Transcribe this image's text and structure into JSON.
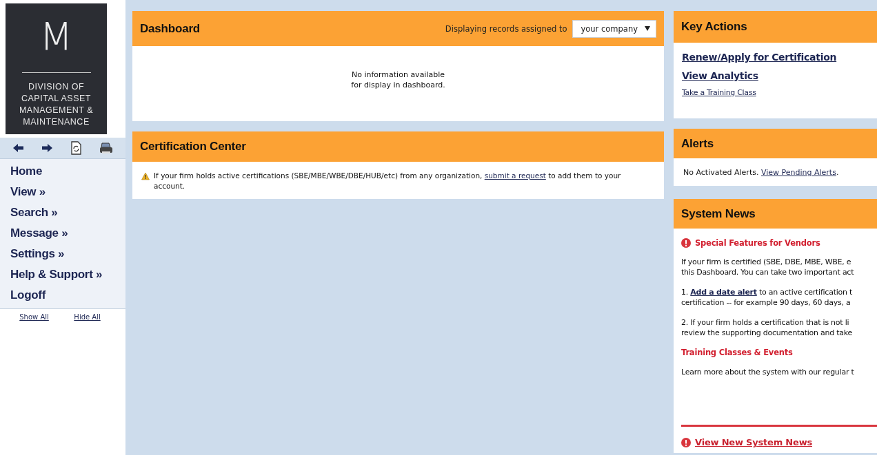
{
  "sidebar": {
    "logo": {
      "monogram": "M",
      "lines": [
        "DIVISION OF",
        "CAPITAL ASSET",
        "MANAGEMENT &",
        "MAINTENANCE"
      ]
    },
    "toolbar": [
      {
        "kind": "back"
      },
      {
        "kind": "forward"
      },
      {
        "kind": "refresh"
      },
      {
        "kind": "print"
      }
    ],
    "nav": [
      {
        "label": "Home"
      },
      {
        "label": "View »"
      },
      {
        "label": "Search »"
      },
      {
        "label": "Message »"
      },
      {
        "label": "Settings »"
      },
      {
        "label": "Help & Support »"
      },
      {
        "label": "Logoff"
      }
    ],
    "show_all": "Show All",
    "hide_all": "Hide All"
  },
  "dashboard": {
    "title": "Dashboard",
    "filter_label": "Displaying records assigned to",
    "filter_value": "your company",
    "message_lines": [
      "No information available",
      "for display in dashboard."
    ]
  },
  "certification_center": {
    "title": "Certification Center",
    "text_before": "If your firm holds active certifications (SBE/MBE/WBE/DBE/HUB/etc) from any organization, ",
    "link": "submit a request",
    "text_after": " to add them to your account."
  },
  "key_actions": {
    "title": "Key Actions",
    "links": [
      {
        "label": "Renew/Apply for Certification",
        "kind": "primary"
      },
      {
        "label": "View Analytics",
        "kind": "primary"
      },
      {
        "label": "Take a Training Class",
        "kind": "secondary"
      }
    ]
  },
  "alerts": {
    "title": "Alerts",
    "text": "No Activated Alerts. ",
    "link": "View Pending Alerts",
    "after": "."
  },
  "system_news": {
    "title": "System News",
    "blocks": [
      {
        "kind": "alert_heading",
        "text": "Special Features for Vendors"
      },
      {
        "kind": "paragraph",
        "lines": [
          {
            "text": "If your firm is certified (SBE, DBE, MBE, WBE, e"
          },
          {
            "text": "this Dashboard. You can take two important act"
          }
        ]
      },
      {
        "kind": "paragraph",
        "lines": [
          {
            "before": "1. ",
            "link": "Add a date alert",
            "after": " to an active certification t"
          },
          {
            "text": "certification -- for example 90 days, 60 days, a"
          }
        ]
      },
      {
        "kind": "paragraph",
        "lines": [
          {
            "text": "2. If your firm holds a certification that is not li"
          },
          {
            "text": "review the supporting documentation and take"
          }
        ]
      },
      {
        "kind": "subheading",
        "text": "Training Classes & Events"
      },
      {
        "kind": "paragraph",
        "lines": [
          {
            "text": "Learn more about the system with our regular t"
          }
        ]
      },
      {
        "kind": "footer_link",
        "text": "View New System News"
      }
    ]
  }
}
